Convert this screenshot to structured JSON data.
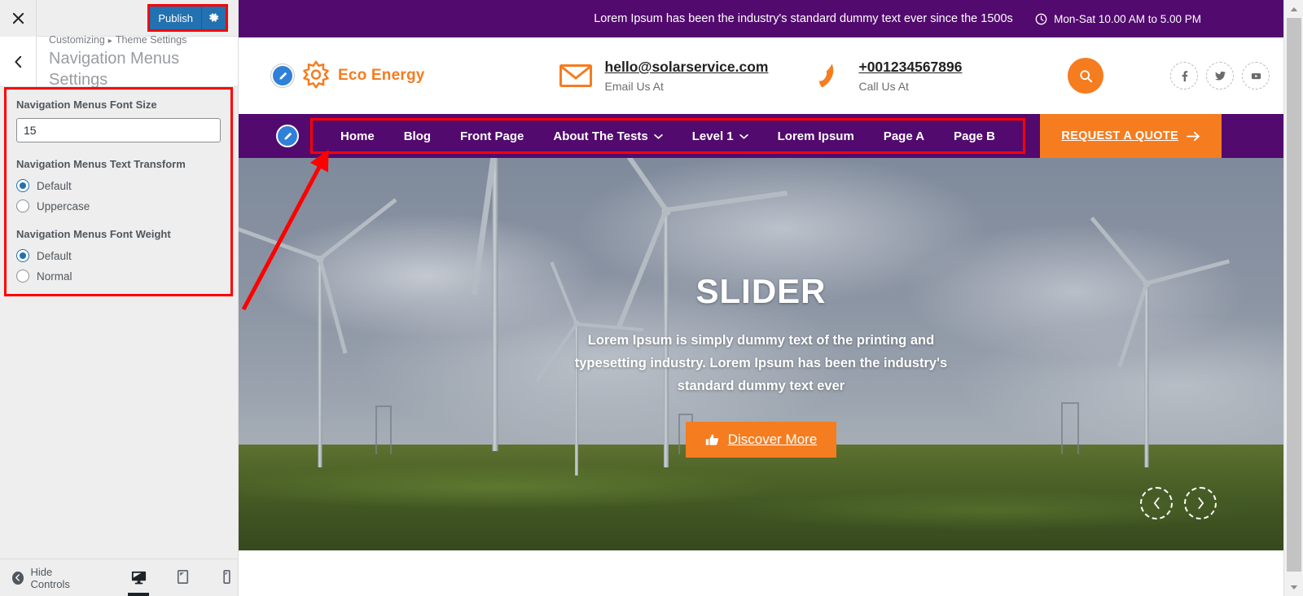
{
  "customizer": {
    "close_icon": "close-icon",
    "publish_label": "Publish",
    "publish_gear_icon": "gear-icon",
    "back_icon": "chevron-left-icon",
    "breadcrumb_root": "Customizing",
    "breadcrumb_sep": "▸",
    "breadcrumb_parent": "Theme Settings",
    "panel_title": "Navigation Menus Settings",
    "fields": {
      "font_size": {
        "label": "Navigation Menus Font Size",
        "value": "15"
      },
      "text_transform": {
        "label": "Navigation Menus Text Transform",
        "options": [
          {
            "label": "Default",
            "selected": true
          },
          {
            "label": "Uppercase",
            "selected": false
          }
        ]
      },
      "font_weight": {
        "label": "Navigation Menus Font Weight",
        "options": [
          {
            "label": "Default",
            "selected": true
          },
          {
            "label": "Normal",
            "selected": false
          }
        ]
      }
    },
    "footer": {
      "hide_controls_label": "Hide Controls",
      "devices": [
        {
          "name": "desktop",
          "icon": "desktop-icon",
          "active": true
        },
        {
          "name": "tablet",
          "icon": "tablet-icon",
          "active": false
        },
        {
          "name": "mobile",
          "icon": "mobile-icon",
          "active": false
        }
      ]
    }
  },
  "site": {
    "topbar": {
      "message": "Lorem Ipsum has been the industry's standard dummy text ever since the 1500s",
      "hours_icon": "clock-icon",
      "hours": "Mon-Sat 10.00 AM to 5.00 PM"
    },
    "header": {
      "logo_icon": "sun-icon",
      "logo_text": "Eco Energy",
      "email_icon": "envelope-icon",
      "email": "hello@solarservice.com",
      "email_caption": "Email Us At",
      "phone_icon": "phone-icon",
      "phone": "+001234567896",
      "phone_caption": "Call Us At",
      "search_icon": "search-icon",
      "socials": [
        {
          "name": "facebook",
          "icon": "facebook-icon"
        },
        {
          "name": "twitter",
          "icon": "twitter-icon"
        },
        {
          "name": "youtube",
          "icon": "youtube-icon"
        }
      ]
    },
    "nav": {
      "items": [
        {
          "label": "Home",
          "has_dropdown": false
        },
        {
          "label": "Blog",
          "has_dropdown": false
        },
        {
          "label": "Front Page",
          "has_dropdown": false
        },
        {
          "label": "About The Tests",
          "has_dropdown": true
        },
        {
          "label": "Level 1",
          "has_dropdown": true
        },
        {
          "label": "Lorem Ipsum",
          "has_dropdown": false
        },
        {
          "label": "Page A",
          "has_dropdown": false
        },
        {
          "label": "Page B",
          "has_dropdown": false
        }
      ],
      "quote_label": "REQUEST A QUOTE",
      "quote_icon": "arrow-right-icon"
    },
    "slider": {
      "title": "SLIDER",
      "description": "Lorem Ipsum is simply dummy text of the printing and typesetting industry. Lorem Ipsum has been the industry's standard dummy text ever",
      "button_label": "Discover More",
      "button_icon": "thumbs-up-icon",
      "prev_icon": "chevron-left-icon",
      "next_icon": "chevron-right-icon"
    }
  },
  "colors": {
    "purple": "#520A6E",
    "orange": "#F57C1F",
    "wp_blue": "#2271B1",
    "annotation_red": "#FF0000"
  }
}
